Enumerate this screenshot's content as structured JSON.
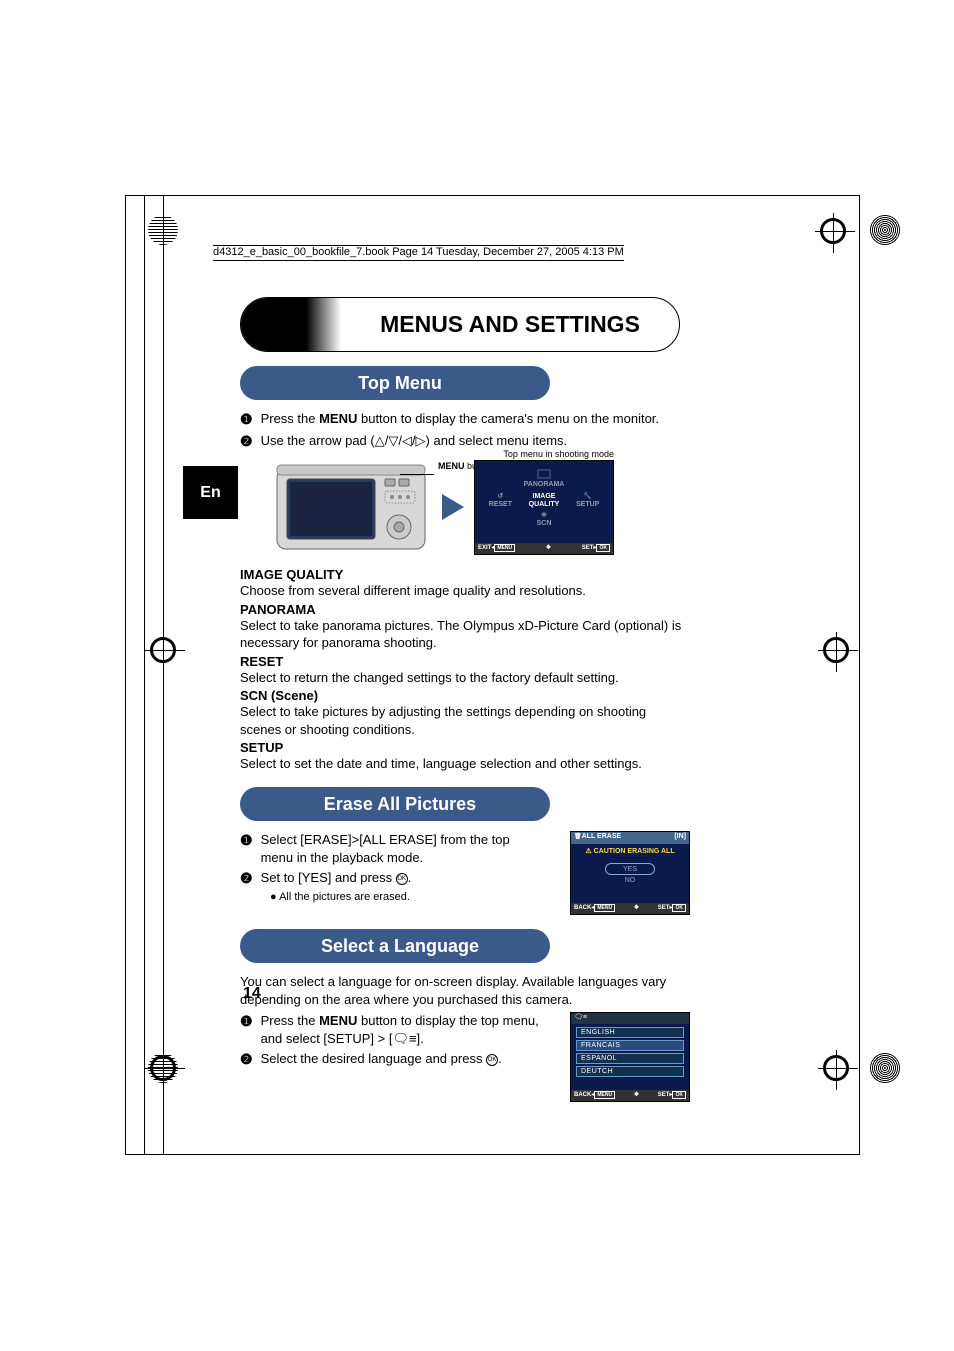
{
  "page_header": "d4312_e_basic_00_bookfile_7.book  Page 14  Tuesday, December 27, 2005  4:13 PM",
  "lang_tab": "En",
  "title": "MENUS AND SETTINGS",
  "sec1": {
    "title": "Top Menu",
    "step1_pre": "Press the ",
    "step1_bold": "MENU",
    "step1_post": " button to display the camera's menu on the monitor.",
    "step2": "Use the arrow pad (△/▽/◁/▷) and select menu items.",
    "label_menu_btn_pre": "MENU",
    "label_menu_btn_post": " button",
    "label_top_menu": "Top menu in shooting mode",
    "menu": {
      "panorama": "PANORAMA",
      "reset": "RESET",
      "image_quality": "IMAGE\nQUALITY",
      "setup": "SETUP",
      "scn": "SCN",
      "exit": "EXIT",
      "menu_box": "MENU",
      "set": "SET",
      "ok_box": "OK"
    },
    "iq_h": "IMAGE QUALITY",
    "iq_b": "Choose from several different image quality and resolutions.",
    "pano_h": "PANORAMA",
    "pano_b": "Select to take panorama pictures. The Olympus xD-Picture Card (optional) is necessary for panorama shooting.",
    "reset_h": "RESET",
    "reset_b": "Select to return the changed settings to the factory default setting.",
    "scn_h": "SCN (Scene)",
    "scn_b": "Select to take pictures by adjusting the settings depending on shooting scenes or shooting conditions.",
    "setup_h": "SETUP",
    "setup_b": "Select to set the date and time, language selection and other settings."
  },
  "sec2": {
    "title": "Erase All Pictures",
    "step1": "Select [ERASE]>[ALL ERASE] from the top menu in the playback mode.",
    "step2": "Set to [YES] and press ",
    "bullet": "All the pictures are erased.",
    "screen": {
      "header_l": "ALL ERASE",
      "header_r": "[IN]",
      "caution": "CAUTION ERASING ALL",
      "yes": "YES",
      "no": "NO",
      "back": "BACK",
      "menu_box": "MENU",
      "set": "SET",
      "ok_box": "OK"
    }
  },
  "sec3": {
    "title": "Select a Language",
    "intro": "You can select a language for on-screen display. Available languages vary depending on the area where you purchased this camera.",
    "step1_pre": "Press the ",
    "step1_bold": "MENU",
    "step1_post": " button to display the top menu, and select [SETUP] > [",
    "step1_end": "].",
    "step2": "Select the desired language and press ",
    "screen": {
      "english": "ENGLISH",
      "francais": "FRANCAIS",
      "espanol": "ESPANOL",
      "deutch": "DEUTCH",
      "back": "BACK",
      "menu_box": "MENU",
      "set": "SET",
      "ok_box": "OK"
    }
  },
  "page_number": "14"
}
